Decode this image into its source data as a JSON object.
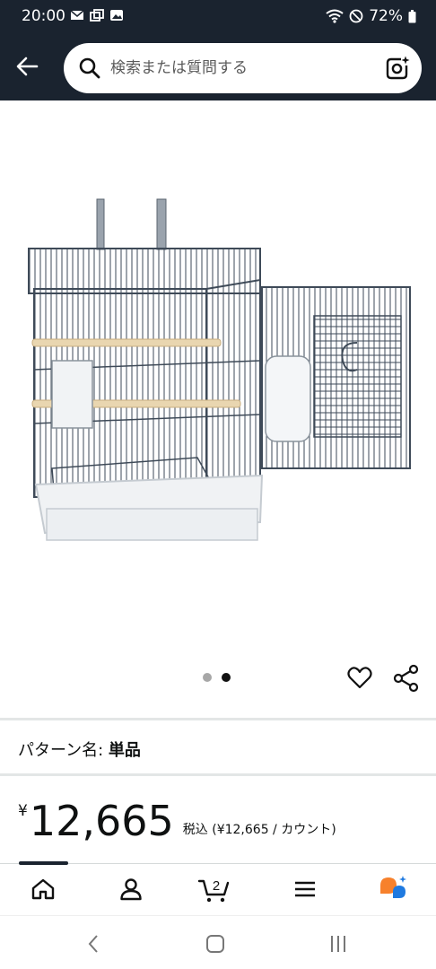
{
  "status_bar": {
    "time": "20:00",
    "battery": "72%",
    "icons": [
      "mail-icon",
      "tabs-icon",
      "image-icon",
      "wifi-icon",
      "do-not-disturb-icon",
      "battery-icon"
    ]
  },
  "header": {
    "search_placeholder": "検索または質問する",
    "icons": [
      "back-arrow-icon",
      "search-icon",
      "camera-icon"
    ]
  },
  "product": {
    "image_count": 2,
    "active_image": 2,
    "variant_label": "パターン名: ",
    "variant_value": "単品",
    "price_symbol": "¥",
    "price": "12,665",
    "tax_note": "税込 (¥12,665 / カウント)"
  },
  "bottom_nav": {
    "items": [
      "home-icon",
      "account-icon",
      "cart-icon",
      "menu-icon",
      "ai-assistant-icon"
    ],
    "cart_count": "2"
  },
  "colors": {
    "header_bg": "#1a232f",
    "divider": "#e3e6e6",
    "text": "#0f1111",
    "accent_orange": "#f7812c",
    "accent_blue": "#1f7ae0"
  }
}
